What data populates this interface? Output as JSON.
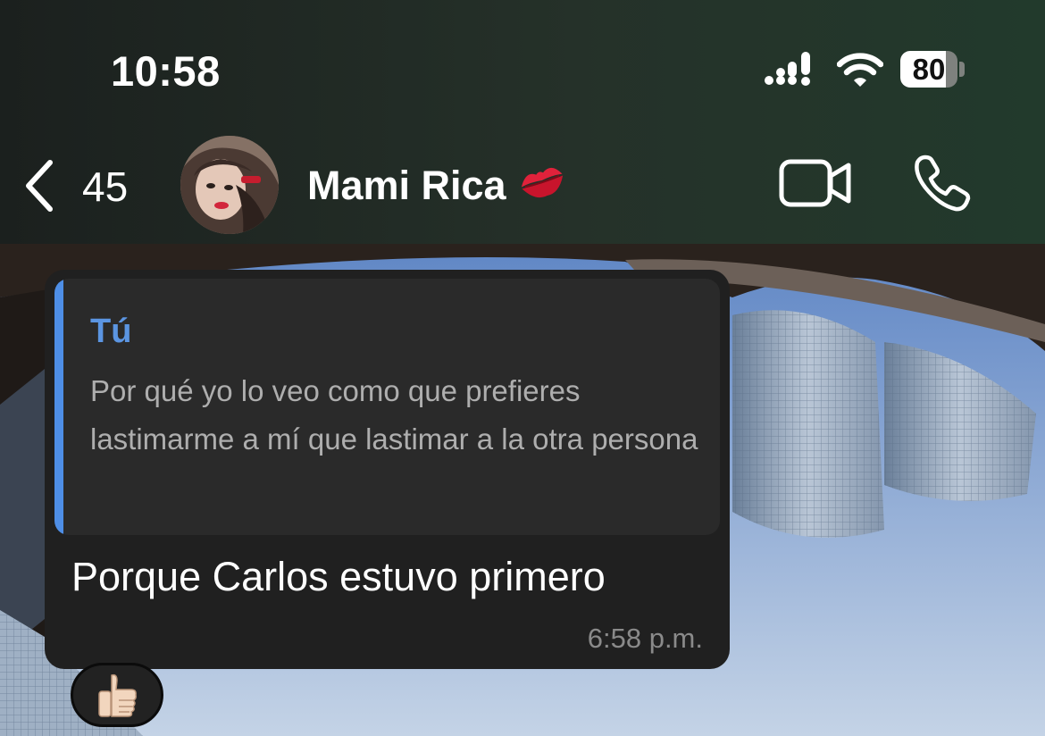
{
  "status_bar": {
    "time": "10:58",
    "battery_level": "80",
    "battery_fraction": 0.8,
    "icons": [
      "signal-icon",
      "wifi-icon",
      "battery-icon"
    ]
  },
  "header": {
    "back_icon": "chevron-left-icon",
    "unread_count": "45",
    "contact_name": "Mami Rica",
    "contact_emoji": "kiss-lips-emoji",
    "actions": [
      "video-call-icon",
      "phone-call-icon"
    ]
  },
  "message": {
    "quoted": {
      "author": "Tú",
      "text": "Por qué yo lo veo como que prefieres lastimarme a mí que lastimar a la otra persona"
    },
    "text": "Porque Carlos estuvo primero",
    "time": "6:58 p.m.",
    "reaction": "thumbs-up-emoji"
  },
  "colors": {
    "header_bg": "#222a25",
    "bubble_bg": "#202020",
    "quote_bg": "#2a2a2a",
    "accent_blue": "#5b95e2"
  }
}
